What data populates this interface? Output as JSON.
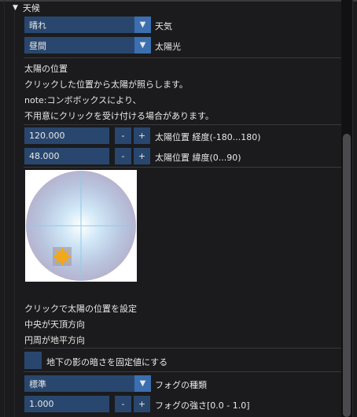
{
  "section": {
    "title": "天候"
  },
  "weather": {
    "value": "晴れ",
    "label": "天気"
  },
  "sunlight": {
    "value": "昼間",
    "label": "太陽光"
  },
  "sun_position": {
    "heading": "太陽の位置",
    "desc1": "クリックした位置から太陽が照らします。",
    "desc2": "note:コンボボックスにより、",
    "desc3": "不用意にクリックを受け付ける場合があります。",
    "longitude": {
      "value": "120.000",
      "label": "太陽位置 経度(-180...180)"
    },
    "latitude": {
      "value": "48.000",
      "label": "太陽位置 緯度(0...90)"
    },
    "minus": "-",
    "plus": "+",
    "help1": "クリックで太陽の位置を設定",
    "help2": "中央が天頂方向",
    "help3": "円周が地平方向"
  },
  "shadow": {
    "label": "地下の影の暗さを固定値にする",
    "checked": false
  },
  "fog": {
    "type_value": "標準",
    "type_label": "フォグの種類",
    "strength_value": "1.000",
    "strength_label": "フォグの強さ[0.0 - 1.0]"
  },
  "colors": {
    "field": "#29476e",
    "button": "#3b6fb0",
    "sun": "#f0a81c"
  }
}
